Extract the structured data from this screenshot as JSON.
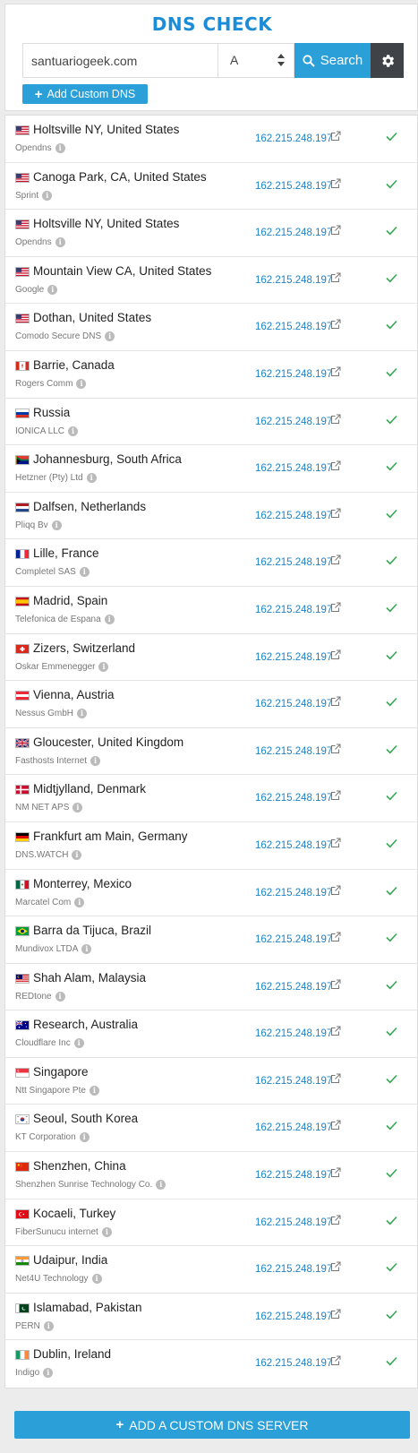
{
  "header": {
    "title": "DNS CHECK",
    "domain_value": "santuariogeek.com",
    "record_type": "A",
    "search_label": "Search",
    "add_custom_label": "Add Custom DNS"
  },
  "footer": {
    "add_server_label": "ADD A CUSTOM DNS SERVER"
  },
  "colors": {
    "accent": "#2a9fd8",
    "title": "#1b8cd8",
    "ip": "#1b83c9",
    "ok": "#3aa655"
  },
  "results": [
    {
      "location": "Holtsville NY, United States",
      "provider": "Opendns",
      "ip": "162.215.248.197",
      "flag": "us",
      "status": "ok"
    },
    {
      "location": "Canoga Park, CA, United States",
      "provider": "Sprint",
      "ip": "162.215.248.197",
      "flag": "us",
      "status": "ok"
    },
    {
      "location": "Holtsville NY, United States",
      "provider": "Opendns",
      "ip": "162.215.248.197",
      "flag": "us",
      "status": "ok"
    },
    {
      "location": "Mountain View CA, United States",
      "provider": "Google",
      "ip": "162.215.248.197",
      "flag": "us",
      "status": "ok"
    },
    {
      "location": "Dothan, United States",
      "provider": "Comodo Secure DNS",
      "ip": "162.215.248.197",
      "flag": "us",
      "status": "ok"
    },
    {
      "location": "Barrie, Canada",
      "provider": "Rogers Comm",
      "ip": "162.215.248.197",
      "flag": "ca",
      "status": "ok"
    },
    {
      "location": "Russia",
      "provider": "IONICA LLC",
      "ip": "162.215.248.197",
      "flag": "ru",
      "status": "ok"
    },
    {
      "location": "Johannesburg, South Africa",
      "provider": "Hetzner (Pty) Ltd",
      "ip": "162.215.248.197",
      "flag": "za",
      "status": "ok"
    },
    {
      "location": "Dalfsen, Netherlands",
      "provider": "Pliqq Bv",
      "ip": "162.215.248.197",
      "flag": "nl",
      "status": "ok"
    },
    {
      "location": "Lille, France",
      "provider": "Completel SAS",
      "ip": "162.215.248.197",
      "flag": "fr",
      "status": "ok"
    },
    {
      "location": "Madrid, Spain",
      "provider": "Telefonica de Espana",
      "ip": "162.215.248.197",
      "flag": "es",
      "status": "ok"
    },
    {
      "location": "Zizers, Switzerland",
      "provider": "Oskar Emmenegger",
      "ip": "162.215.248.197",
      "flag": "ch",
      "status": "ok"
    },
    {
      "location": "Vienna, Austria",
      "provider": "Nessus GmbH",
      "ip": "162.215.248.197",
      "flag": "at",
      "status": "ok"
    },
    {
      "location": "Gloucester, United Kingdom",
      "provider": "Fasthosts Internet",
      "ip": "162.215.248.197",
      "flag": "gb",
      "status": "ok"
    },
    {
      "location": "Midtjylland, Denmark",
      "provider": "NM NET APS",
      "ip": "162.215.248.197",
      "flag": "dk",
      "status": "ok"
    },
    {
      "location": "Frankfurt am Main, Germany",
      "provider": "DNS.WATCH",
      "ip": "162.215.248.197",
      "flag": "de",
      "status": "ok"
    },
    {
      "location": "Monterrey, Mexico",
      "provider": "Marcatel Com",
      "ip": "162.215.248.197",
      "flag": "mx",
      "status": "ok"
    },
    {
      "location": "Barra da Tijuca, Brazil",
      "provider": "Mundivox LTDA",
      "ip": "162.215.248.197",
      "flag": "br",
      "status": "ok"
    },
    {
      "location": "Shah Alam, Malaysia",
      "provider": "REDtone",
      "ip": "162.215.248.197",
      "flag": "my",
      "status": "ok"
    },
    {
      "location": "Research, Australia",
      "provider": "Cloudflare Inc",
      "ip": "162.215.248.197",
      "flag": "au",
      "status": "ok"
    },
    {
      "location": "Singapore",
      "provider": "Ntt Singapore Pte",
      "ip": "162.215.248.197",
      "flag": "sg",
      "status": "ok"
    },
    {
      "location": "Seoul, South Korea",
      "provider": "KT Corporation",
      "ip": "162.215.248.197",
      "flag": "kr",
      "status": "ok"
    },
    {
      "location": "Shenzhen, China",
      "provider": "Shenzhen Sunrise Technology Co.",
      "ip": "162.215.248.197",
      "flag": "cn",
      "status": "ok"
    },
    {
      "location": "Kocaeli, Turkey",
      "provider": "FiberSunucu internet",
      "ip": "162.215.248.197",
      "flag": "tr",
      "status": "ok"
    },
    {
      "location": "Udaipur, India",
      "provider": "Net4U Technology",
      "ip": "162.215.248.197",
      "flag": "in",
      "status": "ok"
    },
    {
      "location": "Islamabad, Pakistan",
      "provider": "PERN",
      "ip": "162.215.248.197",
      "flag": "pk",
      "status": "ok"
    },
    {
      "location": "Dublin, Ireland",
      "provider": "Indigo",
      "ip": "162.215.248.197",
      "flag": "ie",
      "status": "ok"
    }
  ]
}
